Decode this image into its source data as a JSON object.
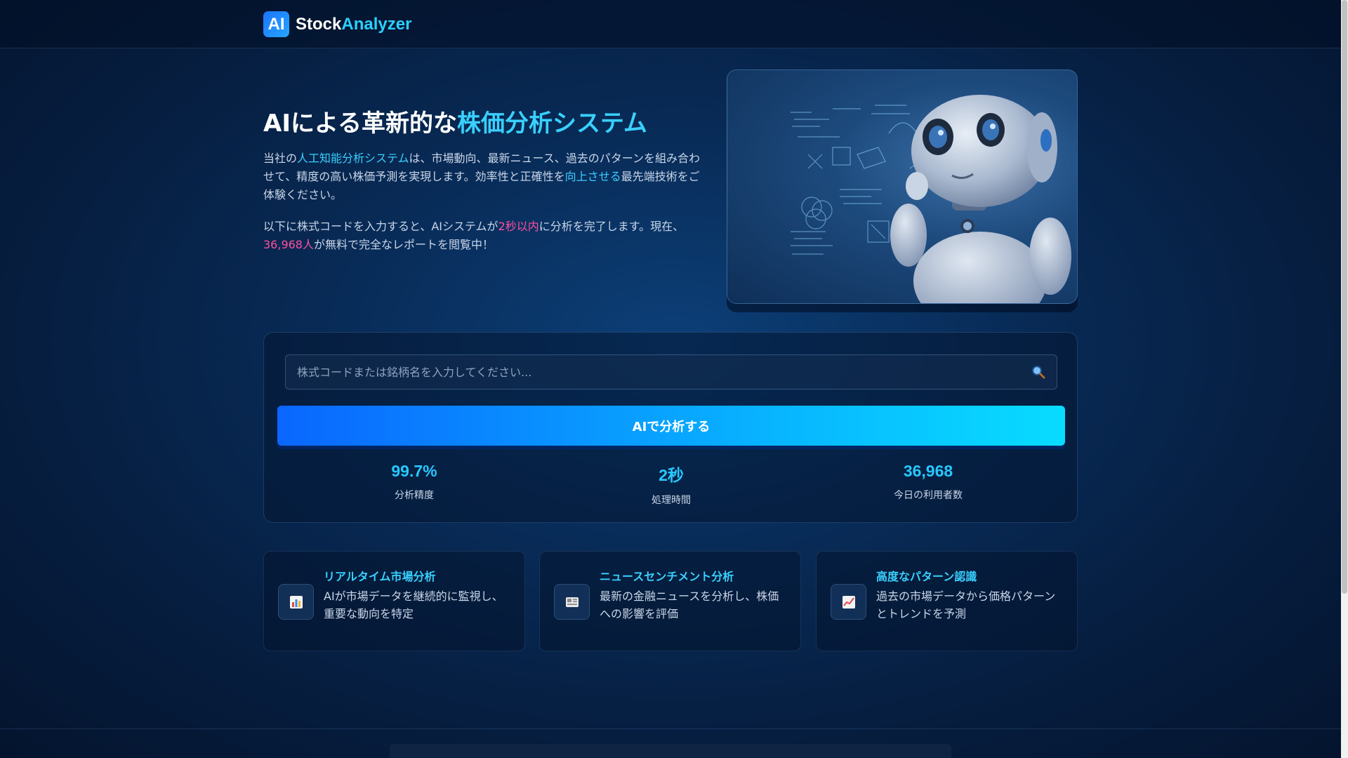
{
  "brand": {
    "badge": "AI",
    "name_part1": "Stock",
    "name_part2": "Analyzer"
  },
  "hero": {
    "title_part1": "AIによる革新的な",
    "title_part2": "株価分析システム",
    "para1": {
      "t1": "当社の",
      "hl1": "人工知能分析システム",
      "t2": "は、市場動向、最新ニュース、過去のパターンを組み合わせて、精度の高い株価予測を実現します。効率性と正確性を",
      "hl2": "向上させる",
      "t3": "最先端技術をご体験ください。"
    },
    "para2": {
      "t1": "以下に株式コードを入力すると、AIシステムが",
      "hl1": "2秒以内",
      "t2": "に分析を完了します。現在、",
      "hl2": "36,968人",
      "t3": "が無料で完全なレポートを閲覧中！"
    },
    "image_icon": "ai-robot-image"
  },
  "analyzer": {
    "search_placeholder": "株式コードまたは銘柄名を入力してください...",
    "search_icon": "search-icon",
    "button_label": "AIで分析する",
    "stats": [
      {
        "value": "99.7%",
        "label": "分析精度"
      },
      {
        "value": "2秒",
        "label": "処理時間"
      },
      {
        "value": "36,968",
        "label": "今日の利用者数"
      }
    ]
  },
  "features": [
    {
      "icon": "bar-chart-icon",
      "title": "リアルタイム市場分析",
      "desc": "AIが市場データを継続的に監視し、重要な動向を特定"
    },
    {
      "icon": "newspaper-icon",
      "title": "ニュースセンチメント分析",
      "desc": "最新の金融ニュースを分析し、株価への影響を評価"
    },
    {
      "icon": "trend-chart-icon",
      "title": "高度なパターン認識",
      "desc": "過去の市場データから価格パターンとトレンドを予測"
    }
  ],
  "colors": {
    "accent": "#39d0ff",
    "highlight": "#ff4fa0",
    "button_start": "#0a66ff",
    "button_end": "#08dcff"
  }
}
